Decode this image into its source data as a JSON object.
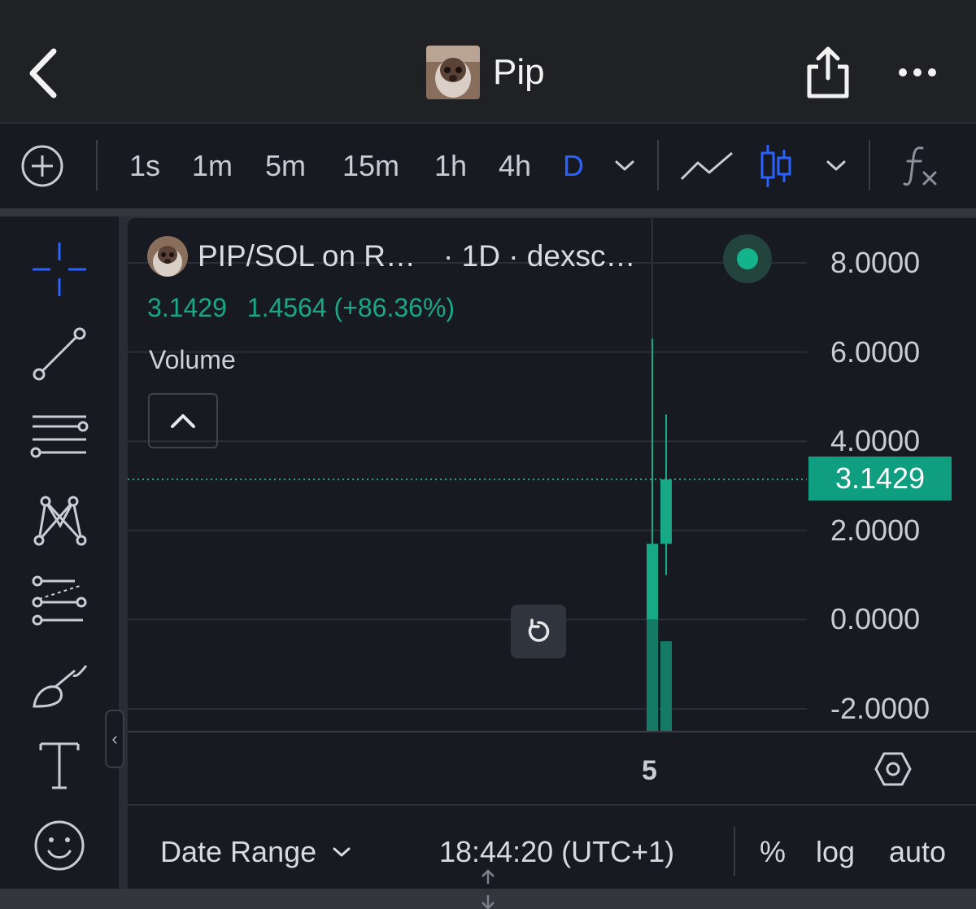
{
  "header": {
    "title": "Pip",
    "icons": [
      "chevron-left-icon",
      "share-icon",
      "more-icon"
    ]
  },
  "toolbar": {
    "intervals": [
      {
        "label": "1s",
        "active": false
      },
      {
        "label": "1m",
        "active": false
      },
      {
        "label": "5m",
        "active": false
      },
      {
        "label": "15m",
        "active": false
      },
      {
        "label": "1h",
        "active": false
      },
      {
        "label": "4h",
        "active": false
      },
      {
        "label": "D",
        "active": true
      }
    ],
    "active_color": "#2962ff",
    "icons": [
      "add-circle-icon",
      "chevron-down-icon",
      "line-chart-icon",
      "candlestick-icon",
      "chevron-down-icon",
      "function-icon"
    ]
  },
  "drawing_tools": [
    "crosshair-icon",
    "trend-line-icon",
    "horizontal-lines-icon",
    "pattern-icon",
    "forecast-icon",
    "brush-icon",
    "text-icon",
    "emoji-icon"
  ],
  "legend": {
    "pair": "PIP/SOL on R…",
    "meta": "· 1D · dexsc…",
    "last": "3.1429",
    "change": "1.4564 (+86.36%)",
    "volume_label": "Volume",
    "up_color": "#17a888"
  },
  "chart_data": {
    "type": "candlestick",
    "y_ticks": [
      "8.0000",
      "6.0000",
      "4.0000",
      "2.0000",
      "0.0000",
      "-2.0000"
    ],
    "ylim": [
      -2,
      8
    ],
    "last_price": "3.1429",
    "x_ticks": [
      "5"
    ],
    "candles": [
      {
        "open": 1.7,
        "high": 6.3,
        "low": -0.2,
        "close": 0.0,
        "direction": "up"
      },
      {
        "open": 1.7,
        "high": 4.6,
        "low": 1.0,
        "close": 3.1429,
        "direction": "up"
      }
    ]
  },
  "footer": {
    "date_range": "Date Range",
    "clock": "18:44:20 (UTC+1)",
    "percent": "%",
    "log": "log",
    "auto": "auto"
  }
}
